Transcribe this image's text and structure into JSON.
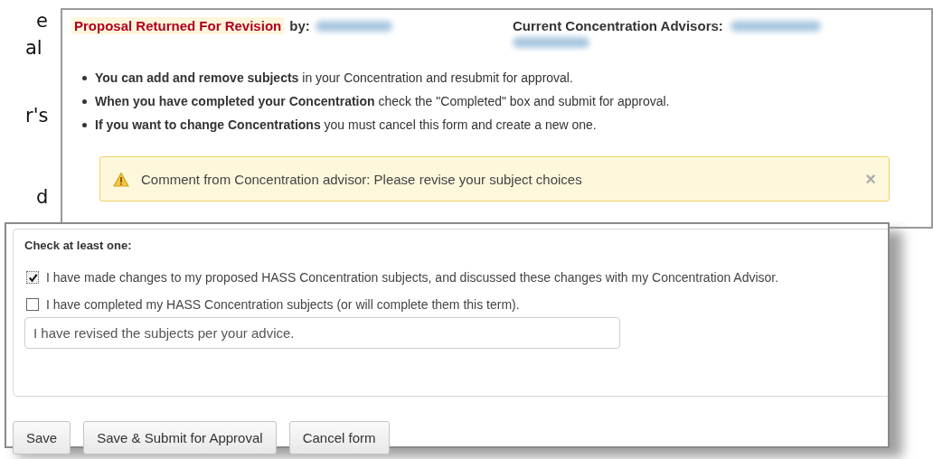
{
  "document_margin_text": [
    "e",
    "al",
    "r's",
    "d"
  ],
  "status_panel": {
    "status": "Proposal Returned For Revision",
    "by_label": "by:",
    "advisors_label": "Current Concentration Advisors:",
    "instructions": [
      "**You can add and remove subjects** in your Concentration and resubmit for approval.",
      "**When you have completed your Concentration** check the \"Completed\" box and submit for approval.",
      "**If you want to change Concentrations** you must cancel this form and create a new one."
    ],
    "alert": {
      "kind": "warning",
      "message": "Comment from Concentration advisor: Please revise your subject choices",
      "close": "×"
    }
  },
  "form": {
    "heading": "Check at least one:",
    "options": [
      {
        "label": "I have made changes to my proposed HASS Concentration subjects, and discussed these changes with my Concentration Advisor.",
        "checked": true
      },
      {
        "label": "I have completed my HASS Concentration subjects (or will complete them this term).",
        "checked": false
      }
    ],
    "comment": {
      "value": "I have revised the subjects per your advice."
    },
    "buttons": [
      "Save",
      "Save & Submit for Approval",
      "Cancel form"
    ]
  }
}
